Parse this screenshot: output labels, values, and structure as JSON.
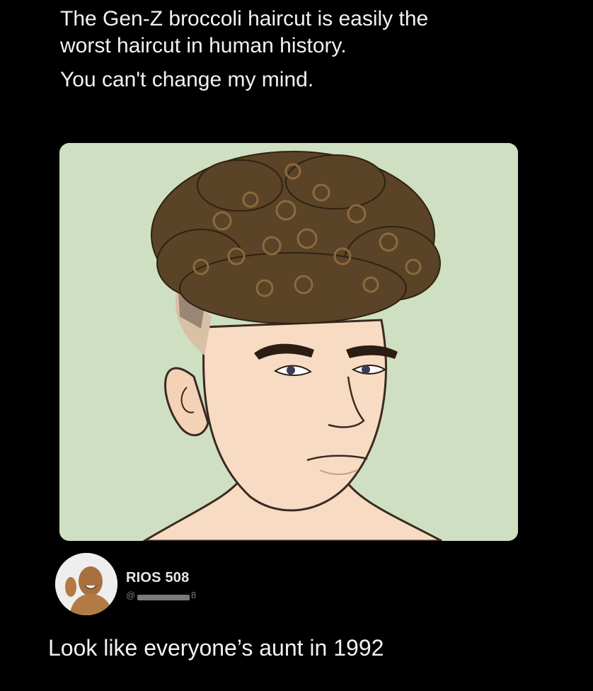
{
  "post": {
    "line1": "The Gen-Z broccoli haircut is easily the",
    "line2": "worst haircut in human history.",
    "line3": "You can't change my mind."
  },
  "reply": {
    "name": "RIOS 508",
    "handle_prefix": "@",
    "handle_tail": "8",
    "text": "Look like everyone’s aunt in 1992"
  },
  "colors": {
    "background": "#000000",
    "illustration_bg": "#cfe0c2",
    "hair": "#5a4326",
    "skin": "#f7dcc3"
  }
}
